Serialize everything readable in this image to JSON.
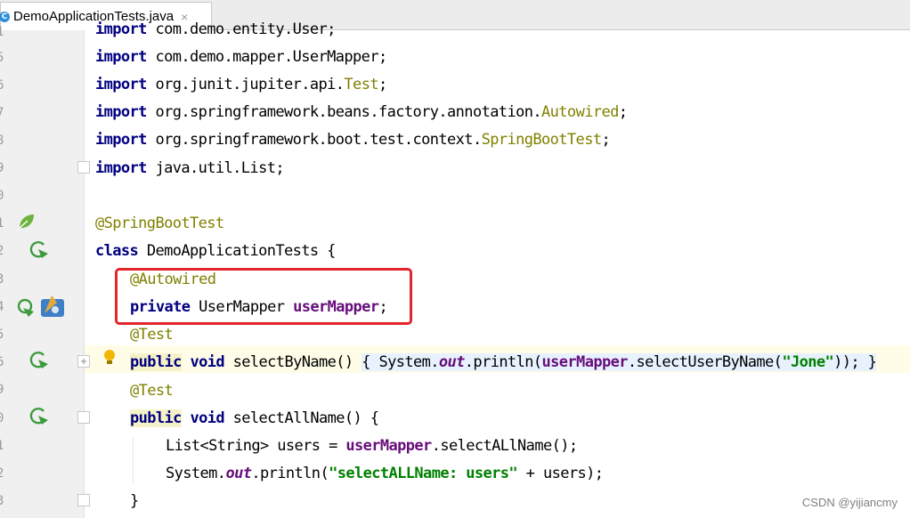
{
  "tab": {
    "title": "DemoApplicationTests.java",
    "close": "×",
    "icon": "java-class-icon"
  },
  "gutter": {
    "line_numbers": [
      "1",
      "5",
      "6",
      "7",
      "8",
      "9",
      "0",
      "1",
      "2",
      "3",
      "4",
      "5",
      "6",
      "9",
      "0",
      "1",
      "2",
      "3"
    ]
  },
  "code": {
    "l0": {
      "kw": "import",
      "rest": " com.demo.entity.User;"
    },
    "l1": {
      "kw": "import",
      "rest": " com.demo.mapper.UserMapper;"
    },
    "l2": {
      "kw": "import",
      "rest": " org.junit.jupiter.api.",
      "cls": "Test",
      "end": ";"
    },
    "l3": {
      "kw": "import",
      "rest": " org.springframework.beans.factory.annotation.",
      "cls": "Autowired",
      "end": ";"
    },
    "l4": {
      "kw": "import",
      "rest": " org.springframework.boot.test.context.",
      "cls": "SpringBootTest",
      "end": ";"
    },
    "l5": {
      "kw": "import",
      "rest": " java.util.List;"
    },
    "l7": {
      "ann": "@SpringBootTest"
    },
    "l8": {
      "kw": "class",
      "rest": " DemoApplicationTests {"
    },
    "l9": {
      "ann": "@Autowired"
    },
    "l10": {
      "kw": "private",
      "rest": " UserMapper ",
      "field": "userMapper",
      "end": ";"
    },
    "l11": {
      "ann": "@Test"
    },
    "l12": {
      "kw1": "public",
      "kw2": "void",
      "a": " selectByName() ",
      "b": "{ System.",
      "stat": "out",
      "c": ".println(",
      "field": "userMapper",
      "d": ".selectUserByName(",
      "str": "\"Jone\"",
      "e": ")); }"
    },
    "l13": {
      "ann": "@Test"
    },
    "l14": {
      "kw1": "public",
      "kw2": "void",
      "a": " selectAllName() {"
    },
    "l15": {
      "a": "List<String> users = ",
      "field": "userMapper",
      "b": ".selectALlName();"
    },
    "l16": {
      "a": "System.",
      "stat": "out",
      "b": ".println(",
      "str": "\"selectALLName: users\"",
      "c": " + users);"
    },
    "l17": {
      "a": "}"
    }
  },
  "watermark": "CSDN @yijiancmy",
  "colors": {
    "highlight": "#e3262b",
    "keyword": "#000080",
    "annotation": "#808000",
    "field": "#660e7a",
    "string": "#008000"
  }
}
